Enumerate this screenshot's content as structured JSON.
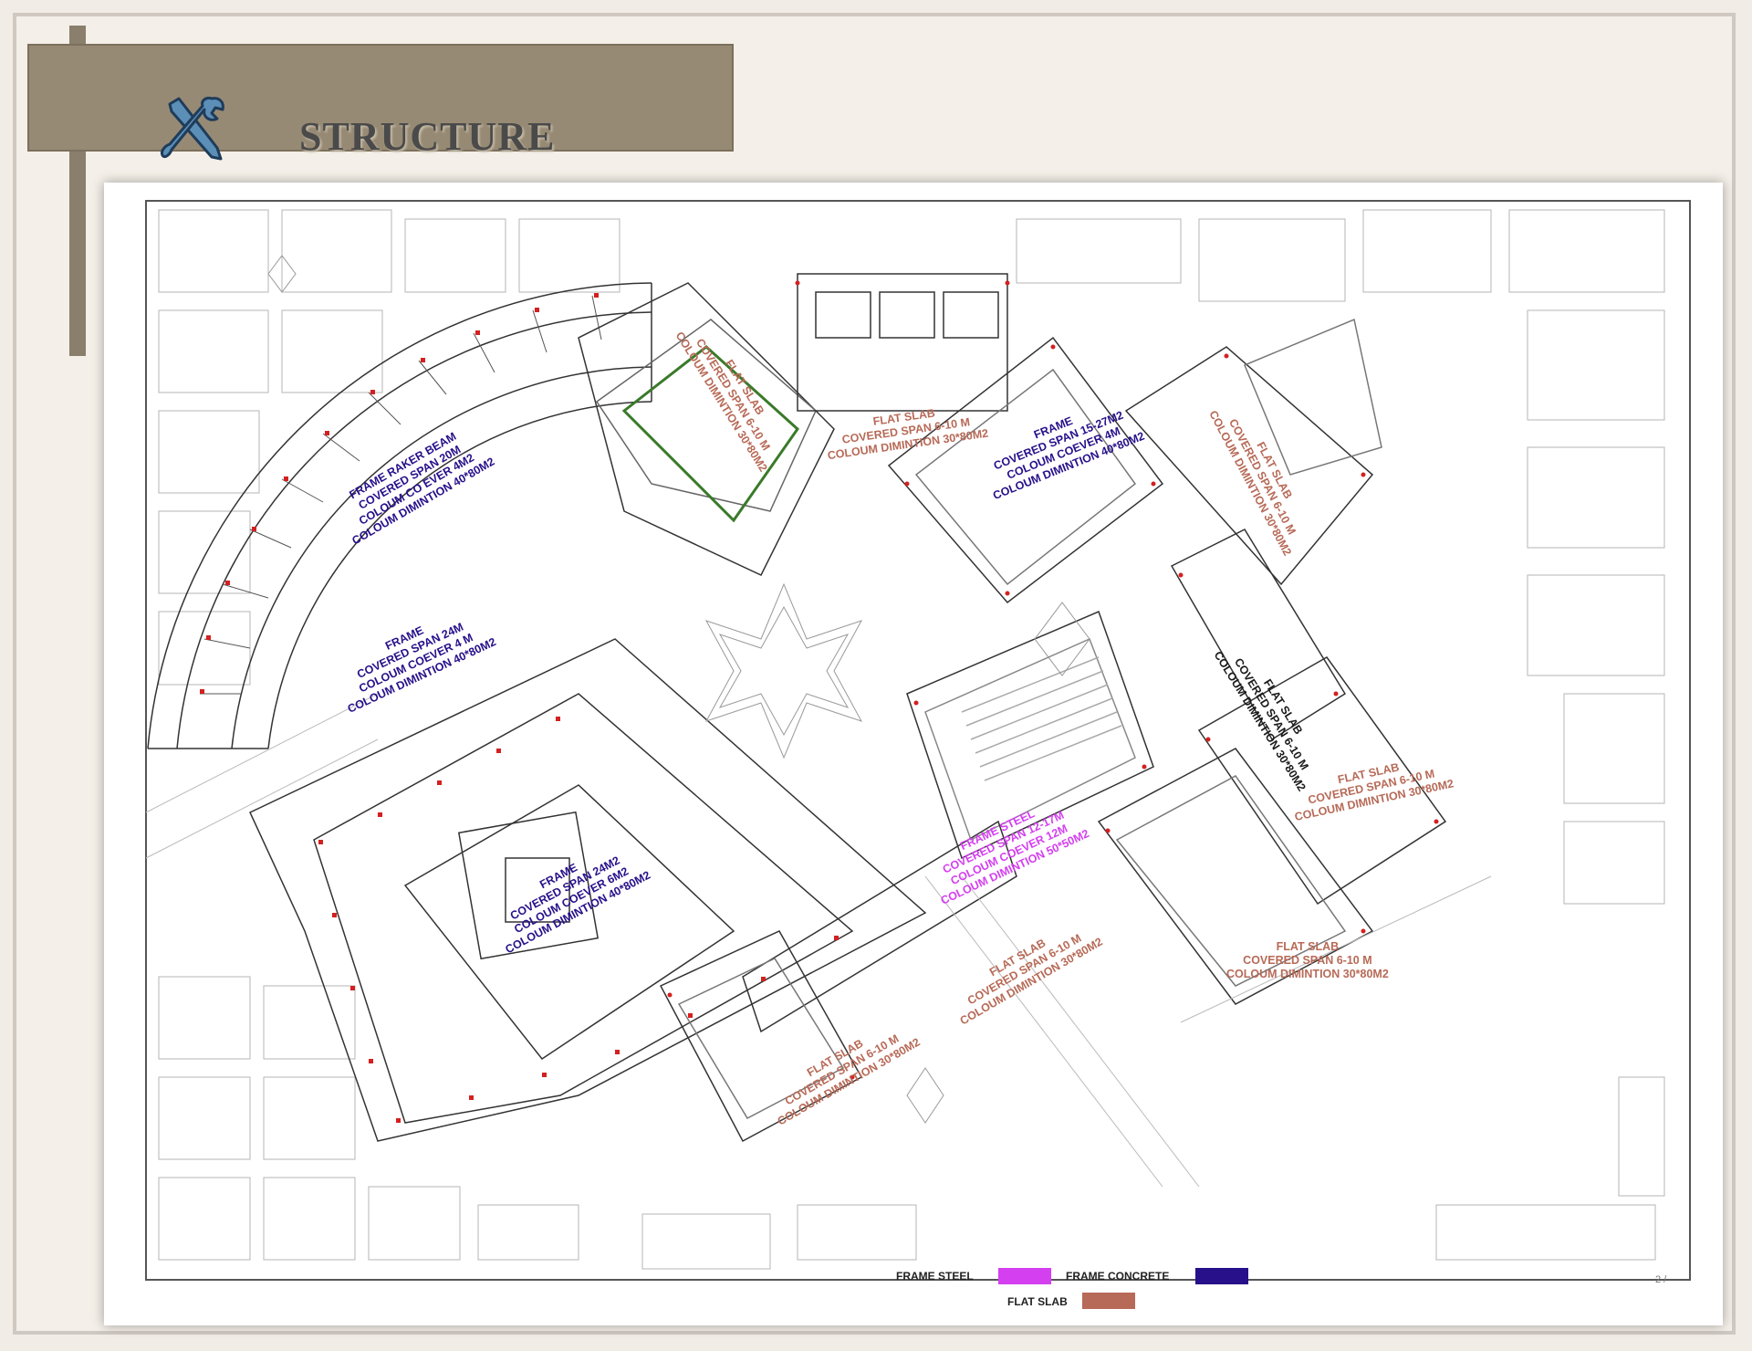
{
  "header": {
    "title": "STRUCTURE",
    "icon": "tools-icon"
  },
  "colors": {
    "frame_steel": "#d43ff0",
    "frame_concrete": "#27108a",
    "flat_slab": "#b76a57",
    "column_marker": "#d42020"
  },
  "zones": [
    {
      "id": "zone-frame-raker",
      "type": "frame_concrete",
      "lines": [
        "FRAME RAKER BEAM",
        "COVERED SPAN 20M",
        "COLOUM CO    EVER 4M2",
        "COLOUM DIMINTION 40*80M2"
      ]
    },
    {
      "id": "zone-frame-24m",
      "type": "frame_concrete",
      "lines": [
        "FRAME",
        "COVERED SPAN 24M",
        "COLOUM COEVER 4 M",
        "COLOUM DIMINTION 40*80M2"
      ]
    },
    {
      "id": "zone-frame-24m2",
      "type": "frame_concrete",
      "lines": [
        "FRAME",
        "COVERED SPAN 24M2",
        "COLOUM COEVER 6M2",
        "COLOUM DIMINTION 40*80M2"
      ]
    },
    {
      "id": "zone-flat-slab-diamond",
      "type": "flat_slab",
      "lines": [
        "FLAT SLAB",
        "COVERED SPAN 6-10 M",
        "COLOUM DIMINTION 30*80M2"
      ]
    },
    {
      "id": "zone-flat-slab-top",
      "type": "flat_slab",
      "lines": [
        "FLAT SLAB",
        "COVERED SPAN 6-10 M",
        "COLOUM DIMINTION 30*80M2"
      ]
    },
    {
      "id": "zone-frame-15-27m",
      "type": "frame_concrete",
      "lines": [
        "FRAME",
        "COVERED SPAN 15-27M2",
        "COLOUM COEVER 4M",
        "COLOUM DIMINTION 40*80M2"
      ]
    },
    {
      "id": "zone-flat-slab-ne",
      "type": "flat_slab",
      "lines": [
        "FLAT SLAB",
        "COVERED SPAN 6-10 M",
        "COLOUM DIMINTION 30*80M2"
      ]
    },
    {
      "id": "zone-flat-slab-east",
      "type": "frame_concrete",
      "lines": [
        "FLAT SLAB",
        "COVERED SPAN 6-10 M",
        "COLOUM DIMINTION 30*80M2"
      ]
    },
    {
      "id": "zone-flat-slab-right",
      "type": "flat_slab",
      "lines": [
        "FLAT SLAB",
        "COVERED SPAN 6-10 M",
        "COLOUM DIMINTION 30*80M2"
      ]
    },
    {
      "id": "zone-frame-steel",
      "type": "frame_steel",
      "lines": [
        "FRAME STEEL",
        "COVERED SPAN 12-17M",
        "COLOUM COEVER 12M",
        "COLOUM DIMINTION 50*50M2"
      ]
    },
    {
      "id": "zone-flat-slab-lower-right",
      "type": "flat_slab",
      "lines": [
        "FLAT SLAB",
        "COVERED SPAN 6-10 M",
        "COLOUM DIMINTION 30*80M2"
      ]
    },
    {
      "id": "zone-flat-slab-bridge",
      "type": "flat_slab",
      "lines": [
        "FLAT SLAB",
        "COVERED SPAN 6-10 M",
        "COLOUM DIMINTION 30*80M2"
      ]
    },
    {
      "id": "zone-flat-slab-bottom",
      "type": "flat_slab",
      "lines": [
        "FLAT SLAB",
        "COVERED SPAN 6-10 M",
        "COLOUM DIMINTION 30*80M2"
      ]
    }
  ],
  "legend": {
    "frame_steel": "FRAME STEEL",
    "frame_concrete": "FRAME CONCRETE",
    "flat_slab": "FLAT SLAB"
  },
  "page_marker": "2 /"
}
